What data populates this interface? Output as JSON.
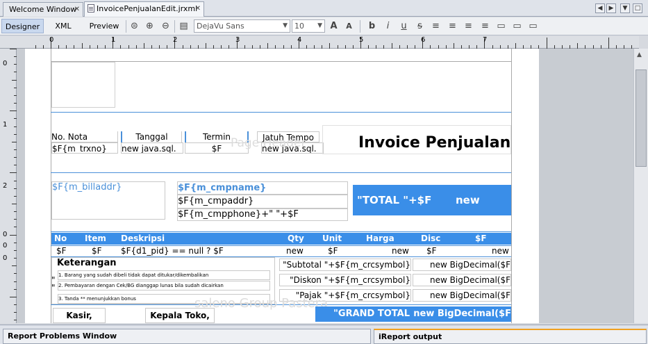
{
  "tabs": [
    {
      "label": "Welcome Window"
    },
    {
      "label": "InvoicePenjualanEdit.jrxml"
    }
  ],
  "toolbar": {
    "designer": "Designer",
    "xml": "XML",
    "preview": "Preview",
    "font_family": "DejaVu Sans",
    "font_size": "10"
  },
  "ruler": {
    "h_labels": [
      "0",
      "1",
      "2",
      "3",
      "4",
      "5",
      "6",
      "7"
    ],
    "v_labels": [
      "0",
      "1",
      "2",
      "0",
      "0",
      "0"
    ]
  },
  "report": {
    "title": "Invoice Penjualan",
    "watermark_top": "Page Header",
    "watermark_bottom": "saleno Group Pastera",
    "headers": {
      "no_nota": "No. Nota",
      "tanggal": "Tanggal",
      "termin": "Termin",
      "jatuh_tempo": "Jatuh Tempo"
    },
    "header_values": {
      "trxno": "$F{m_trxno}",
      "tanggal": "new java.sql.",
      "termin": "$F",
      "jatuh_tempo": "new java.sql."
    },
    "billaddr": "$F{m_billaddr}",
    "cmpname": "$F{m_cmpname}",
    "cmpaddr": "$F{m_cmpaddr}",
    "cmpphone": "$F{m_cmpphone}+\" \"+$F",
    "total_label": "\"TOTAL \"+$F",
    "total_value": "new",
    "columns": {
      "no": "No",
      "item": "Item",
      "deskripsi": "Deskripsi",
      "qty": "Qty",
      "unit": "Unit",
      "harga": "Harga",
      "disc": "Disc",
      "amount": "$F"
    },
    "detail": {
      "no": "$F",
      "item": "$F",
      "deskripsi": "$F{d1_pid} == null ? $F",
      "qty": "new",
      "unit": "$F",
      "harga": "new",
      "disc": "$F",
      "amount": "new"
    },
    "keterangan": "Keterangan",
    "notes": [
      "1. Barang yang sudah dibeli tidak dapat ditukar/dikembalikan",
      "2. Pembayaran dengan Cek/BG dianggap lunas bila sudah dicairkan",
      "3. Tanda ** menunjukkan bonus"
    ],
    "quote_marks": "\"",
    "subtotal_label": "\"Subtotal \"+$F{m_crcsymbol}",
    "subtotal_value": "new BigDecimal($F",
    "diskon_label": "\"Diskon \"+$F{m_crcsymbol}",
    "diskon_value": "new BigDecimal($F",
    "pajak_label": "\"Pajak \"+$F{m_crcsymbol}",
    "pajak_value": "new BigDecimal($F",
    "kasir": "Kasir,",
    "kepala_toko": "Kepala Toko,",
    "grand_total_label": "\"GRAND TOTAL",
    "grand_total_value": "new BigDecimal($F"
  },
  "bottom_tabs": [
    {
      "label": "Report Problems Window"
    },
    {
      "label": "iReport output"
    }
  ],
  "colors": {
    "accent": "#3a8ee8",
    "field_text": "#4a90d9"
  }
}
